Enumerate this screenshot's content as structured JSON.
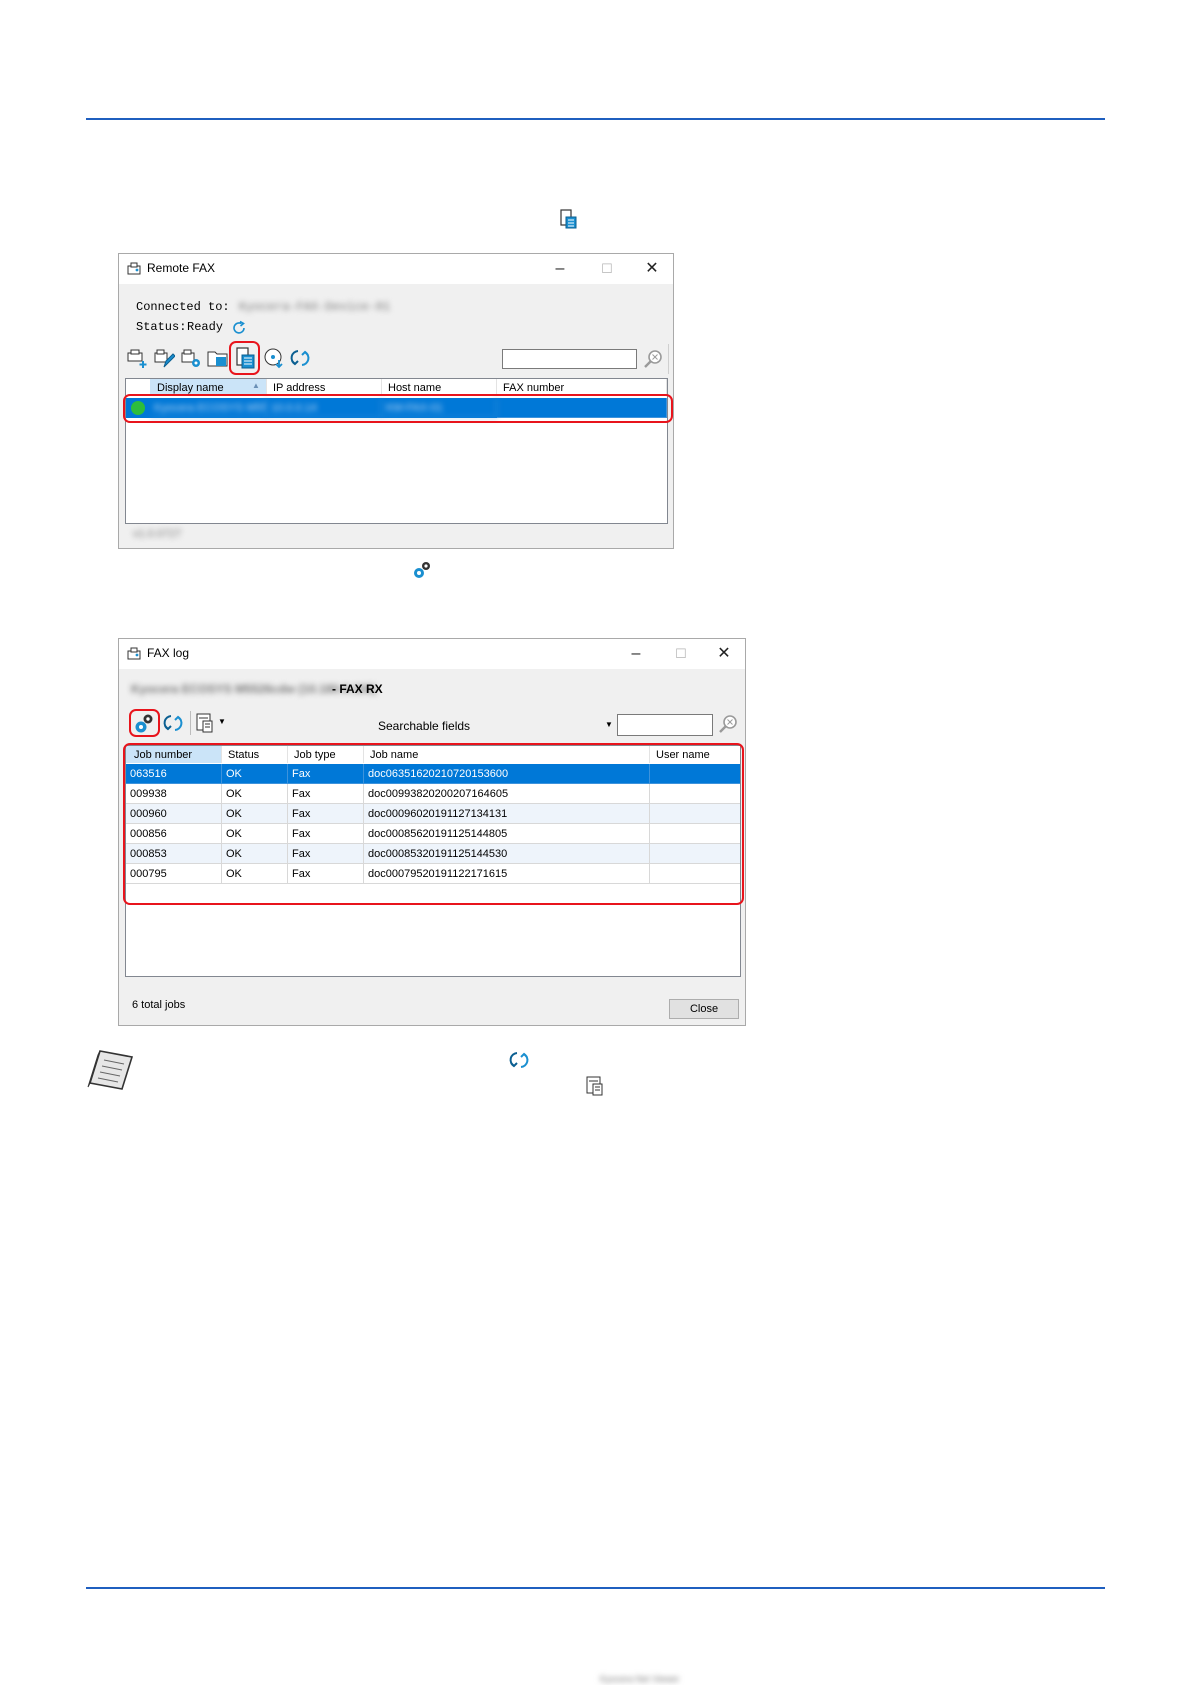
{
  "remote_fax": {
    "title": "Remote FAX",
    "connected_label": "Connected to:",
    "connected_value": "Kyocera-FAX-Device-01",
    "status_label": "Status:",
    "status_value": "Ready",
    "columns": [
      "Display name",
      "IP address",
      "Host name",
      "FAX number"
    ],
    "row_values": [
      "Kyocera ECOSYS M5526",
      "10.0.0.14",
      "KM-FAX-01",
      ""
    ],
    "version": "v1.0.0727",
    "toolbar_icons": [
      "add-device-icon",
      "edit-device-icon",
      "device-settings-icon",
      "folder-device-icon",
      "fax-log-icon",
      "receive-fax-icon",
      "refresh-icon"
    ]
  },
  "fax_log": {
    "title": "FAX log",
    "subtitle_blurred": "Kyocera ECOSYS M5526cdw (10.180.0.155)",
    "subtitle_suffix": "- FAX RX",
    "searchable_fields": "Searchable fields",
    "columns": [
      "Job number",
      "Status",
      "Job type",
      "Job name",
      "User name"
    ],
    "rows": [
      [
        "063516",
        "OK",
        "Fax",
        "doc06351620210720153600",
        ""
      ],
      [
        "009938",
        "OK",
        "Fax",
        "doc00993820200207164605",
        ""
      ],
      [
        "000960",
        "OK",
        "Fax",
        "doc00096020191127134131",
        ""
      ],
      [
        "000856",
        "OK",
        "Fax",
        "doc00085620191125144805",
        ""
      ],
      [
        "000853",
        "OK",
        "Fax",
        "doc00085320191125144530",
        ""
      ],
      [
        "000795",
        "OK",
        "Fax",
        "doc00079520191122171615",
        ""
      ]
    ],
    "total_jobs": "6 total jobs",
    "close_label": "Close"
  },
  "colors": {
    "rule": "#1f5fbf",
    "selection": "#0078d7",
    "highlight": "#e8141c",
    "icon_blue": "#1a8fd0"
  },
  "footer_blurred": "Kyocera Net Viewer"
}
